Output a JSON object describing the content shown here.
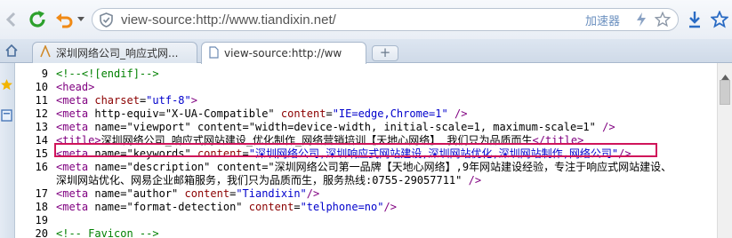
{
  "toolbar": {
    "address": "view-source:http://www.tiandixin.net/",
    "accelerator_label": "加速器",
    "icons": [
      "back-icon",
      "refresh-icon",
      "undo-icon",
      "dropdown-arrow-icon",
      "shield-icon",
      "lightning-icon",
      "favorite-star-icon",
      "download-icon",
      "star-icon"
    ]
  },
  "tabs": [
    {
      "label": "深圳网络公司_响应式网..."
    },
    {
      "label": "view-source:http://ww"
    }
  ],
  "new_tab_label": "+",
  "source_lines": [
    {
      "num": "9",
      "text": "<!--<![endif]-->"
    },
    {
      "num": "10",
      "text": "<head>"
    },
    {
      "num": "11",
      "text": "<meta charset=\"utf-8\">"
    },
    {
      "num": "12",
      "text": "<meta http-equiv=\"X-UA-Compatible\" content=\"IE=edge,Chrome=1\" />"
    },
    {
      "num": "13",
      "text": "<meta name=\"viewport\" content=\"width=device-width, initial-scale=1, maximum-scale=1\" />"
    },
    {
      "num": "14",
      "text": "<title>深圳网络公司_响应式网站建设_优化制作_网络营销培训【天地心网络】 我们只为品质而生</title>"
    },
    {
      "num": "15",
      "text": "<meta name=\"keywords\" content=\"深圳网络公司,深圳响应式网站建设,深圳网站优化,深圳网站制作,网络公司\"/>"
    },
    {
      "num": "16",
      "text": "<meta name=\"description\" content=\"深圳网络公司第一品牌【天地心网络】,9年网站建设经验，专注于响应式网站建设、"
    },
    {
      "num": "",
      "text": "深圳网站优化、网易企业邮箱服务，我们只为品质而生，服务热线:0755-29057711\" />"
    },
    {
      "num": "17",
      "text": "<meta name=\"author\" content=\"Tiandixin\"/>"
    },
    {
      "num": "18",
      "text": "<meta name=\"format-detection\" content=\"telphone=no\"/>"
    },
    {
      "num": "19",
      "text": ""
    },
    {
      "num": "20",
      "text": "<!-- Favicon -->"
    }
  ],
  "highlight_line": "15",
  "colors": {
    "tag": "#800080",
    "attribute": "#8b0000",
    "value": "#0000cc",
    "comment": "#008000",
    "highlight_border": "#d0145a"
  }
}
